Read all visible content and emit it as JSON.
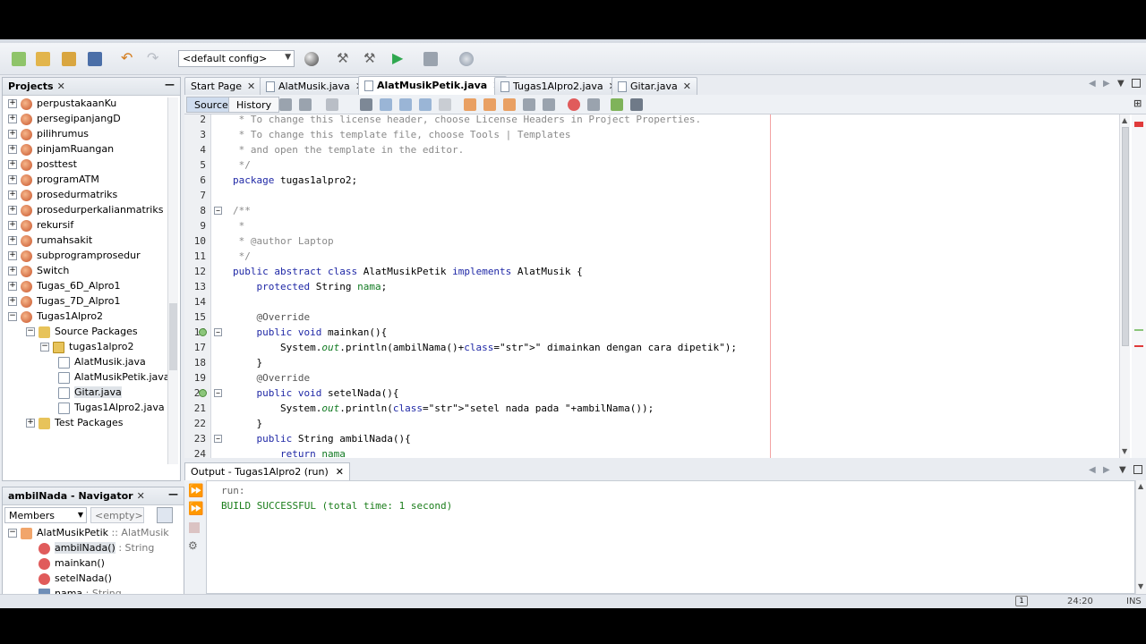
{
  "toolbar": {
    "config_value": "<default config>"
  },
  "projects": {
    "title": "Projects",
    "items": [
      {
        "label": "perpustakaanKu",
        "type": "project"
      },
      {
        "label": "persegipanjangD",
        "type": "project"
      },
      {
        "label": "pilihrumus",
        "type": "project"
      },
      {
        "label": "pinjamRuangan",
        "type": "project"
      },
      {
        "label": "posttest",
        "type": "project"
      },
      {
        "label": "programATM",
        "type": "project"
      },
      {
        "label": "prosedurmatriks",
        "type": "project"
      },
      {
        "label": "prosedurperkalianmatriks",
        "type": "project"
      },
      {
        "label": "rekursif",
        "type": "project"
      },
      {
        "label": "rumahsakit",
        "type": "project"
      },
      {
        "label": "subprogramprosedur",
        "type": "project"
      },
      {
        "label": "Switch",
        "type": "project"
      },
      {
        "label": "Tugas_6D_Alpro1",
        "type": "project"
      },
      {
        "label": "Tugas_7D_Alpro1",
        "type": "project"
      },
      {
        "label": "Tugas1Alpro2",
        "type": "project"
      },
      {
        "label": "Source Packages",
        "type": "folder"
      },
      {
        "label": "tugas1alpro2",
        "type": "package"
      },
      {
        "label": "AlatMusik.java",
        "type": "java"
      },
      {
        "label": "AlatMusikPetik.java",
        "type": "java"
      },
      {
        "label": "Gitar.java",
        "type": "java"
      },
      {
        "label": "Tugas1Alpro2.java",
        "type": "java"
      },
      {
        "label": "Test Packages",
        "type": "folder"
      }
    ]
  },
  "navigator": {
    "title": "ambilNada - Navigator",
    "filter_label": "Members",
    "filter_value": "<empty>",
    "items": [
      {
        "label": "AlatMusikPetik",
        "suffix": " :: AlatMusik"
      },
      {
        "label": "ambilNada()",
        "suffix": " : String"
      },
      {
        "label": "mainkan()",
        "suffix": ""
      },
      {
        "label": "setelNada()",
        "suffix": ""
      },
      {
        "label": "nama",
        "suffix": " : String"
      }
    ]
  },
  "editor_tabs": [
    {
      "label": "Start Page"
    },
    {
      "label": "AlatMusik.java"
    },
    {
      "label": "AlatMusikPetik.java"
    },
    {
      "label": "Tugas1Alpro2.java"
    },
    {
      "label": "Gitar.java"
    }
  ],
  "editor_subtabs": {
    "source": "Source",
    "history": "History"
  },
  "code_lines": [
    {
      "n": "2",
      "text": " * To change this license header, choose License Headers in Project Properties."
    },
    {
      "n": "3",
      "text": " * To change this template file, choose Tools | Templates"
    },
    {
      "n": "4",
      "text": " * and open the template in the editor."
    },
    {
      "n": "5",
      "text": " */"
    },
    {
      "n": "6",
      "text": "package tugas1alpro2;"
    },
    {
      "n": "7",
      "text": ""
    },
    {
      "n": "8",
      "text": "/**"
    },
    {
      "n": "9",
      "text": " *"
    },
    {
      "n": "10",
      "text": " * @author Laptop"
    },
    {
      "n": "11",
      "text": " */"
    },
    {
      "n": "12",
      "text": "public abstract class AlatMusikPetik implements AlatMusik {"
    },
    {
      "n": "13",
      "text": "    protected String nama;"
    },
    {
      "n": "14",
      "text": ""
    },
    {
      "n": "15",
      "text": "    @Override"
    },
    {
      "n": "16",
      "text": "    public void mainkan(){"
    },
    {
      "n": "17",
      "text": "        System.out.println(ambilNama()+\" dimainkan dengan cara dipetik\");"
    },
    {
      "n": "18",
      "text": "    }"
    },
    {
      "n": "19",
      "text": "    @Override"
    },
    {
      "n": "20",
      "text": "    public void setelNada(){"
    },
    {
      "n": "21",
      "text": "        System.out.println(\"setel nada pada \"+ambilNama());"
    },
    {
      "n": "22",
      "text": "    }"
    },
    {
      "n": "23",
      "text": "    public String ambilNada(){"
    },
    {
      "n": "24",
      "text": "        return nama"
    }
  ],
  "output": {
    "tab_label": "Output - Tugas1Alpro2 (run)",
    "lines": [
      "run:",
      "BUILD SUCCESSFUL (total time: 1 second)"
    ]
  },
  "status": {
    "position": "24:20",
    "mode": "INS"
  }
}
